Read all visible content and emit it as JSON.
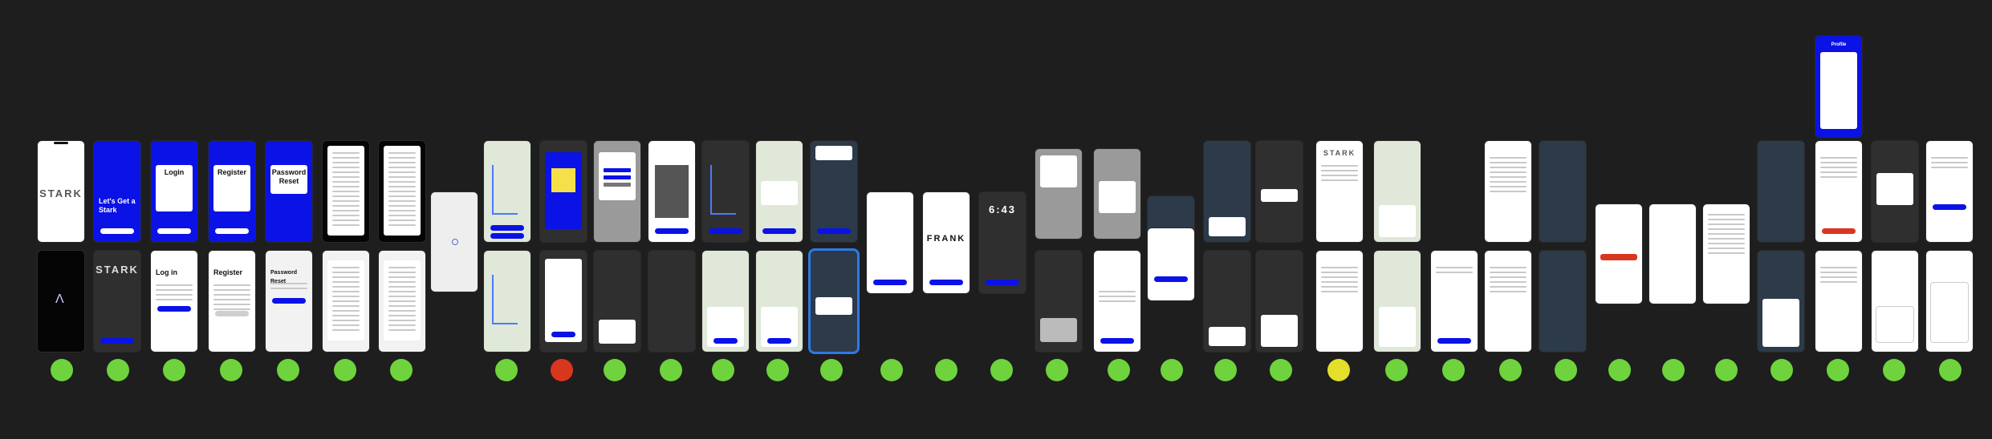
{
  "status_colors": {
    "pass": "#6ed33c",
    "fail": "#d9361f",
    "warn": "#e3df2a"
  },
  "screens": {
    "splash": {
      "logo": "STARK"
    },
    "welcome": {
      "title": "Let's Get a Stark"
    },
    "login_blue": {
      "title": "Login"
    },
    "register_blue": {
      "title": "Register"
    },
    "password_reset_blue": {
      "title": "Password Reset"
    },
    "login_white": {
      "title": "Log in"
    },
    "register_white": {
      "title": "Register"
    },
    "password_reset_white": {
      "title": "Password Reset"
    },
    "frank": {
      "logo": "FRANK"
    },
    "lock_time": {
      "time": "6:43"
    },
    "menu_logo": {
      "logo": "STARK"
    },
    "profile_header": {
      "title": "Profile"
    }
  },
  "status_dots": [
    "pass",
    "pass",
    "pass",
    "pass",
    "pass",
    "pass",
    "pass",
    "pass",
    "fail",
    "pass",
    "pass",
    "pass",
    "pass",
    "pass",
    "pass",
    "pass",
    "pass",
    "pass",
    "pass",
    "pass",
    "pass",
    "pass",
    "warn",
    "pass",
    "pass",
    "pass",
    "pass",
    "pass",
    "pass",
    "pass",
    "pass",
    "pass",
    "pass",
    "pass",
    "pass"
  ]
}
